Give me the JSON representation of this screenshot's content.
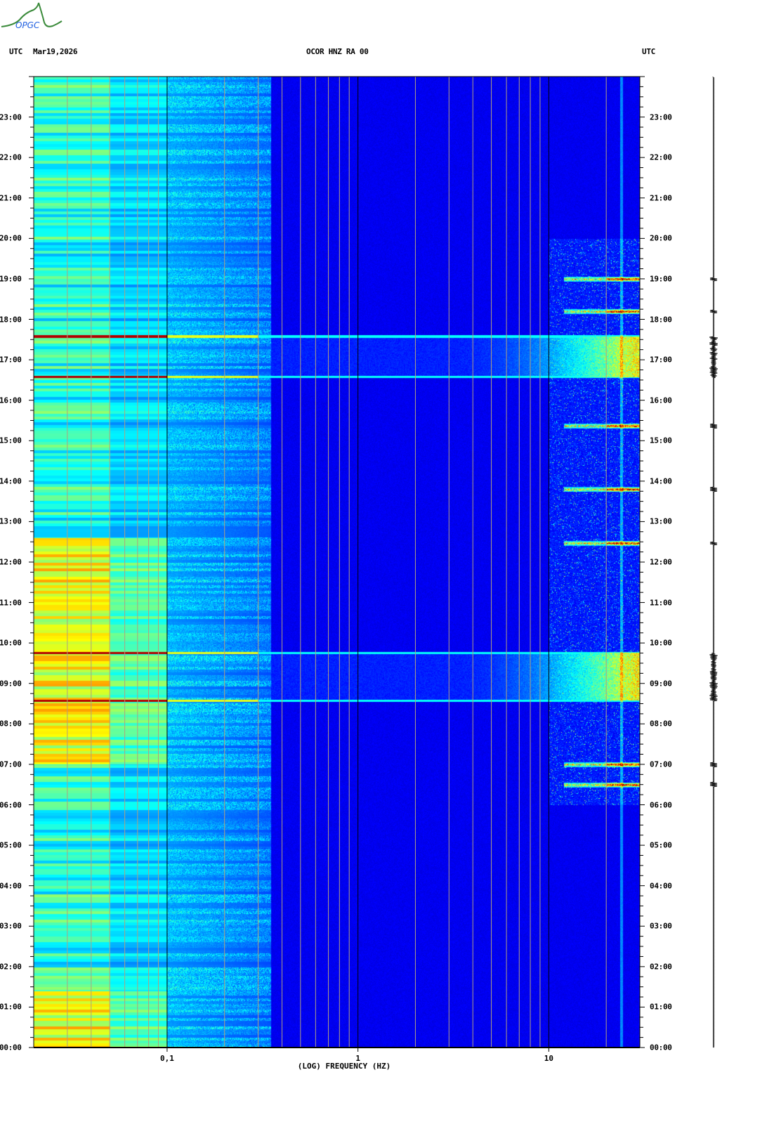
{
  "logo": {
    "text": "OPGC"
  },
  "header": {
    "utc_left": "UTC",
    "date": "Mar19,2026",
    "station": "OCOR HNZ RA 00",
    "utc_right": "UTC"
  },
  "chart_data": {
    "type": "heatmap",
    "title": "OCOR HNZ RA 00",
    "xlabel": "(LOG) FREQUENCY (HZ)",
    "ylabel": "UTC",
    "x_scale": "log",
    "xlim": [
      0.02,
      30
    ],
    "ylim_hours": [
      0,
      24
    ],
    "x_ticks": [
      {
        "value": 0.1,
        "label": "0,1"
      },
      {
        "value": 1,
        "label": "1"
      },
      {
        "value": 10,
        "label": "10"
      }
    ],
    "y_ticks": [
      "00:00",
      "01:00",
      "02:00",
      "03:00",
      "04:00",
      "05:00",
      "06:00",
      "07:00",
      "08:00",
      "09:00",
      "10:00",
      "11:00",
      "12:00",
      "13:00",
      "14:00",
      "15:00",
      "16:00",
      "17:00",
      "18:00",
      "19:00",
      "20:00",
      "21:00",
      "22:00",
      "23:00"
    ],
    "colormap": "jet",
    "broadband_events": [
      {
        "start_hour": 16.58,
        "end_hour": 17.58
      },
      {
        "start_hour": 8.58,
        "end_hour": 9.76
      }
    ],
    "high_freq_events_hour": [
      6.5,
      12.47,
      15.37,
      13.8,
      7.0,
      18.2,
      19.0
    ],
    "low_freq_high_energy_periods": [
      {
        "start_hour": 0.0,
        "end_hour": 1.4
      },
      {
        "start_hour": 7.0,
        "end_hour": 12.6
      }
    ]
  },
  "colors": {
    "gridline": "#b0a080",
    "decade_line": "#000000"
  }
}
